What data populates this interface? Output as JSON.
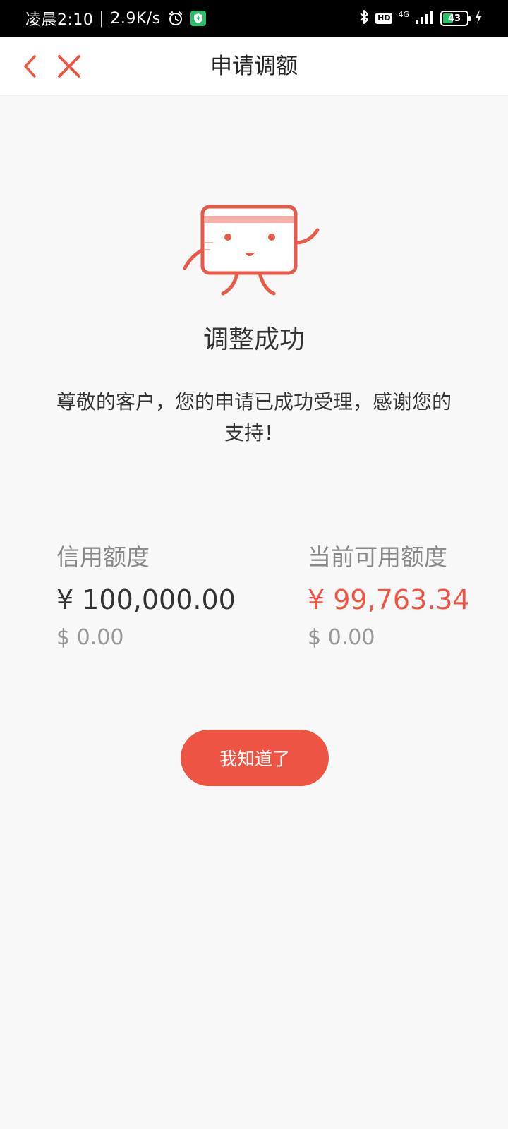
{
  "status_bar": {
    "time": "凌晨2:10",
    "separator": "|",
    "speed": "2.9K/s",
    "hd": "HD",
    "network": "4G",
    "battery": "43"
  },
  "nav": {
    "title": "申请调额",
    "accent_color": "#ee5443"
  },
  "result": {
    "title": "调整成功",
    "message": "尊敬的客户，您的申请已成功受理，感谢您的支持！"
  },
  "limits": {
    "credit": {
      "label": "信用额度",
      "rmb": "¥ 100,000.00",
      "usd": "$ 0.00"
    },
    "available": {
      "label": "当前可用额度",
      "rmb": "¥ 99,763.34",
      "usd": "$ 0.00"
    }
  },
  "button": {
    "label": "我知道了",
    "color": "#ee5443"
  },
  "icons": [
    "alarm-icon",
    "shield-icon",
    "bluetooth-icon",
    "signal-icon",
    "battery-icon",
    "charging-icon",
    "back-icon",
    "close-icon",
    "card-mascot-icon"
  ]
}
